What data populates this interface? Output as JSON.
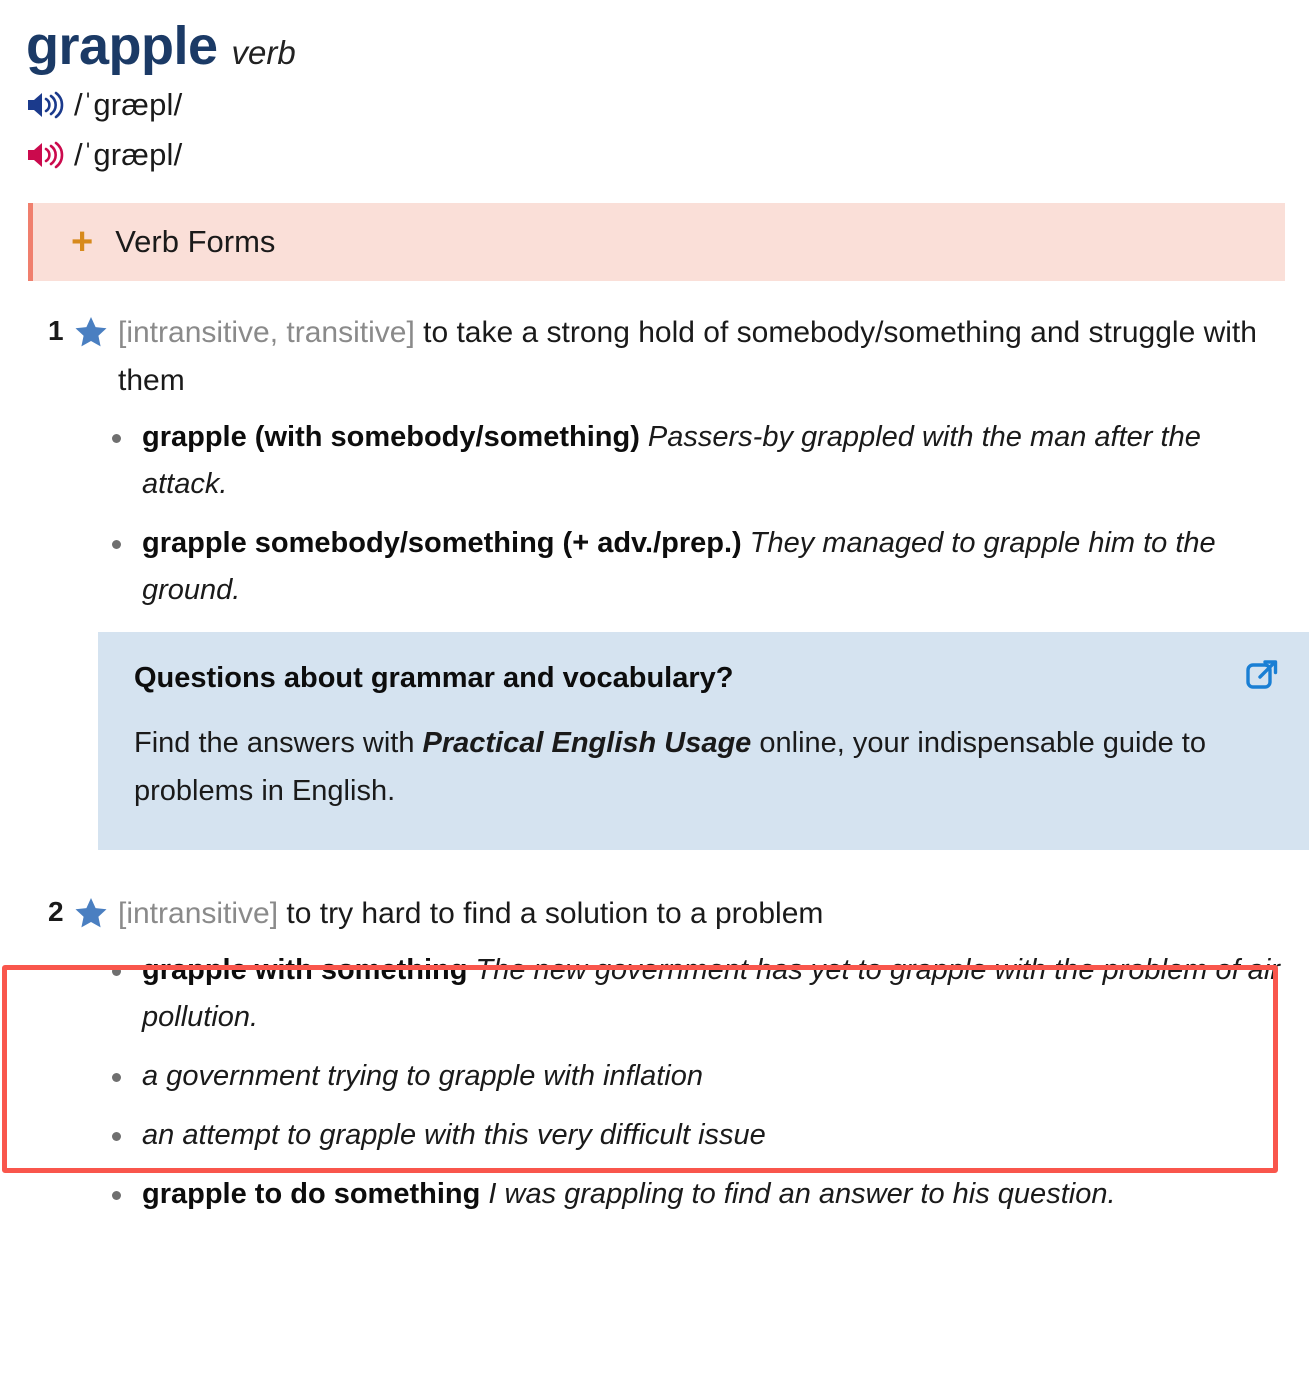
{
  "entry": {
    "headword": "grapple",
    "part_of_speech": "verb",
    "pronunciations": [
      {
        "icon": "speaker-icon",
        "variant": "british",
        "transcription": "/ˈɡræpl/",
        "color": "#1b3a8c"
      },
      {
        "icon": "speaker-icon",
        "variant": "american",
        "transcription": "/ˈɡræpl/",
        "color": "#cb0a4d"
      }
    ]
  },
  "verb_forms": {
    "plus_icon": "plus-icon",
    "label": "Verb Forms",
    "bg_color": "#fadfd8",
    "accent_color": "#f07f6d",
    "icon_color": "#d78a1c"
  },
  "senses": [
    {
      "number": "1",
      "star_icon": "star-icon",
      "grammar": "[intransitive, transitive]",
      "definition": " to take a strong hold of somebody/something and struggle with them",
      "examples": [
        {
          "pattern": "grapple (with somebody/something)",
          "text": "Passers-by grappled with the man after the attack."
        },
        {
          "pattern": "grapple somebody/something (+ adv./prep.)",
          "text": "They managed to grapple him to the ground."
        }
      ]
    },
    {
      "number": "2",
      "star_icon": "star-icon",
      "grammar": "[intransitive]",
      "definition": " to try hard to find a solution to a problem",
      "examples": [
        {
          "pattern": "grapple with something",
          "text": "The new government has yet to grapple with the problem of air pollution."
        }
      ],
      "extra_examples": [
        {
          "pattern": "",
          "text": "a government trying to grapple with inflation"
        },
        {
          "pattern": "",
          "text": "an attempt to grapple with this very difficult issue"
        },
        {
          "pattern": "grapple to do something",
          "text": "I was grappling to find an answer to his question."
        }
      ]
    }
  ],
  "callout": {
    "title": "Questions about grammar and vocabulary?",
    "body_before": "Find the answers with ",
    "body_emphasis": "Practical English Usage",
    "body_after": " online, your indispensable guide to problems in English.",
    "link_icon": "external-link-icon",
    "bg_color": "#d5e3f0",
    "icon_color": "#1a7fd4"
  },
  "annotation": {
    "highlight_color": "#f9564c",
    "target": "sense-2"
  }
}
